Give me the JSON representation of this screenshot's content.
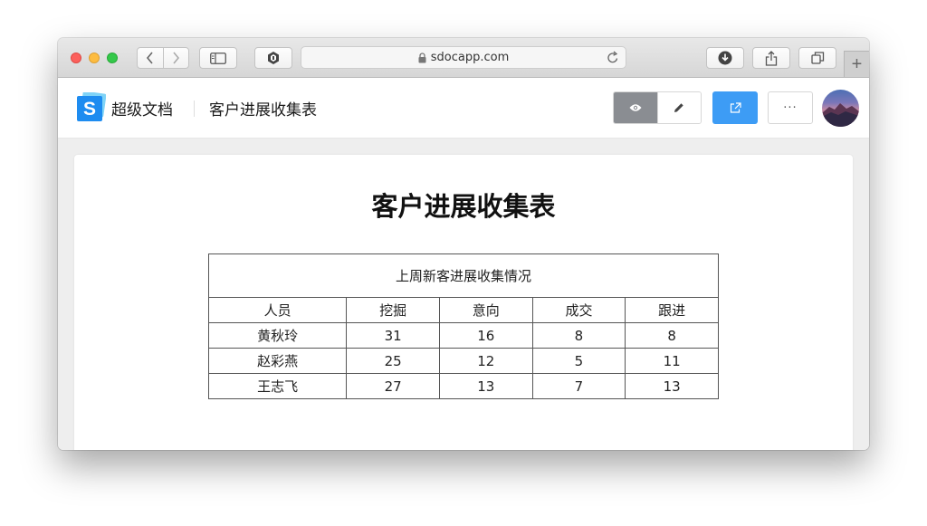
{
  "browser": {
    "url": "sdocapp.com"
  },
  "app": {
    "brand_letter": "S",
    "brand_name": "超级文档",
    "doc_title": "客户进展收集表",
    "more_label": "···"
  },
  "document": {
    "title": "客户进展收集表",
    "table_caption": "上周新客进展收集情况",
    "headers": [
      "人员",
      "挖掘",
      "意向",
      "成交",
      "跟进"
    ],
    "rows": [
      [
        "黄秋玲",
        "31",
        "16",
        "8",
        "8"
      ],
      [
        "赵彩燕",
        "25",
        "12",
        "5",
        "11"
      ],
      [
        "王志飞",
        "27",
        "13",
        "7",
        "13"
      ]
    ]
  },
  "colors": {
    "accent": "#3d9cf5",
    "mode_active": "#8a8d92"
  },
  "icons": {
    "back": "chevron-left-icon",
    "forward": "chevron-right-icon",
    "sidebar": "sidebar-icon",
    "extension": "hexagon-icon",
    "lock": "lock-icon",
    "reload": "reload-icon",
    "download": "download-icon",
    "share": "share-icon",
    "tabs": "tabs-icon",
    "view": "eye-icon",
    "edit": "pencil-icon",
    "export": "export-icon"
  }
}
